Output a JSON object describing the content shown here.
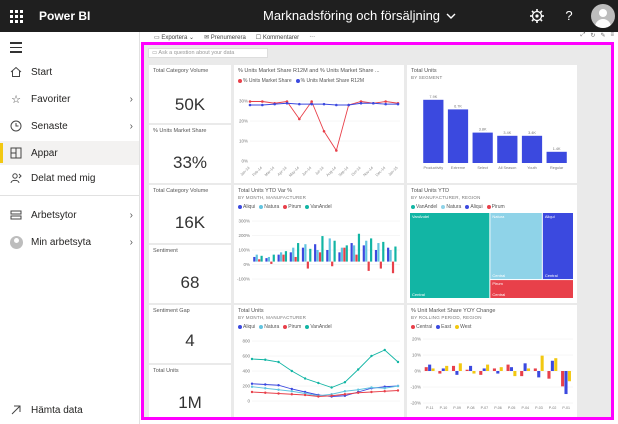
{
  "app": {
    "name": "Power BI",
    "report_title": "Marknadsföring och försäljning"
  },
  "icons": {
    "waffle": "waffle-icon",
    "title_chevron": "chevron-down-icon",
    "settings": "gear-icon",
    "help": "help-icon",
    "account": "avatar-icon"
  },
  "sidebar": {
    "items": [
      {
        "label": "Start",
        "icon": "home-icon"
      },
      {
        "label": "Favoriter",
        "icon": "star-icon",
        "chevron": "›"
      },
      {
        "label": "Senaste",
        "icon": "clock-icon",
        "chevron": "›"
      },
      {
        "label": "Appar",
        "icon": "apps-icon",
        "active": true
      },
      {
        "label": "Delat med mig",
        "icon": "shared-icon"
      },
      {
        "label": "Arbetsytor",
        "icon": "workspaces-icon",
        "chevron": "›"
      },
      {
        "label": "Min arbetsyta",
        "icon": "avatar-icon",
        "chevron": "›"
      }
    ],
    "footer": {
      "label": "Hämta data",
      "icon": "arrow-up-right-icon"
    }
  },
  "actions": {
    "export": "Exportera",
    "subscribe": "Prenumerera",
    "comments": "Kommentarer",
    "more": "···"
  },
  "qa": {
    "placeholder": "Ask a question about your data"
  },
  "tiles": {
    "card1": {
      "title": "Total Category Volume",
      "value": "50K"
    },
    "card2": {
      "title": "% Units Market Share",
      "value": "33%"
    },
    "card3": {
      "title": "Total Category Volume",
      "value": "16K"
    },
    "card4": {
      "title": "Sentiment",
      "value": "68"
    },
    "card5": {
      "title": "Sentiment Gap",
      "value": "4"
    },
    "card6": {
      "title": "Total Units",
      "value": "1M"
    },
    "line1": {
      "title": "% Units Market Share R12M and % Units Market Share ..."
    },
    "bar1": {
      "title": "Total Units",
      "subtitle": "BY SEGMENT"
    },
    "col1": {
      "title": "Total Units YTD Var %",
      "subtitle": "BY MONTH, MANUFACTURER"
    },
    "tree1": {
      "title": "Total Units YTD",
      "subtitle": "BY MANUFACTURER, REGION"
    },
    "line2": {
      "title": "Total Units",
      "subtitle": "BY MONTH, MANUFACTURER"
    },
    "col2": {
      "title": "% Unit Market Share YOY Change",
      "subtitle": "BY ROLLING PERIOD, REGION"
    }
  },
  "colors": {
    "aliqui": "#3b49df",
    "natura": "#62c4e0",
    "pirum": "#e8404a",
    "vanandel": "#12b5a4",
    "central": "#e8404a",
    "east": "#3b49df",
    "west": "#f2c811",
    "bar": "#3b49df",
    "accent": "#f2c811",
    "selection": "#ff00ff"
  },
  "chart_data": [
    {
      "id": "line1",
      "type": "line",
      "series": [
        {
          "name": "% Units Market Share",
          "color": "#e8404a",
          "values": [
            34,
            34,
            33,
            34,
            24,
            34,
            17,
            6,
            32,
            34,
            33,
            34,
            33
          ]
        },
        {
          "name": "% Units Market Share R12M",
          "color": "#3b49df",
          "values": [
            32,
            32,
            32.5,
            33,
            32.5,
            32.5,
            32.5,
            32,
            32,
            33,
            33,
            32.5,
            32.5
          ]
        }
      ],
      "categories": [
        "Jan-14",
        "Feb-14",
        "Mar-14",
        "Apr-14",
        "May-14",
        "Jun-14",
        "Jul-14",
        "Aug-14",
        "Sep-14",
        "Oct-14",
        "Nov-14",
        "Dec-14",
        "Jan-15"
      ],
      "y_ticks": [
        "30%",
        "20%",
        "10%",
        "0%"
      ],
      "ylim": [
        0,
        40
      ]
    },
    {
      "id": "bar1",
      "type": "bar",
      "categories": [
        "Productivity",
        "Extreme",
        "Select",
        "All Season",
        "Youth",
        "Regular"
      ],
      "values": [
        7.9,
        6.7,
        3.8,
        3.4,
        3.4,
        1.4
      ],
      "data_labels": [
        "7.9K",
        "6.7K",
        "3.8K",
        "3.4K",
        "3.4K",
        "1.4K"
      ]
    },
    {
      "id": "col1",
      "type": "bar",
      "legend": [
        {
          "name": "Aliqui",
          "color": "#3b49df"
        },
        {
          "name": "Natura",
          "color": "#62c4e0"
        },
        {
          "name": "Pirum",
          "color": "#e8404a"
        },
        {
          "name": "VanAndel",
          "color": "#12b5a4"
        }
      ],
      "y_ticks": [
        "300%",
        "200%",
        "100%",
        "0%",
        "-100%"
      ],
      "ylim": [
        -150,
        350
      ],
      "series": [
        {
          "name": "Aliqui",
          "values": [
            40,
            30,
            60,
            80,
            120,
            150,
            100,
            80,
            160,
            140,
            100,
            120
          ]
        },
        {
          "name": "Natura",
          "values": [
            60,
            40,
            80,
            120,
            150,
            100,
            200,
            120,
            140,
            180,
            160,
            100
          ]
        },
        {
          "name": "Pirum",
          "values": [
            20,
            -20,
            60,
            40,
            -60,
            80,
            -40,
            120,
            60,
            -80,
            -60,
            -100
          ]
        },
        {
          "name": "VanAndel",
          "values": [
            50,
            60,
            90,
            160,
            110,
            220,
            180,
            140,
            240,
            200,
            170,
            130
          ]
        }
      ]
    },
    {
      "id": "tree1",
      "type": "heatmap",
      "cells": [
        {
          "label": "VanAndel",
          "sub": "Central",
          "value": 45,
          "color": "#12b5a4"
        },
        {
          "label": "Natura",
          "sub": "Central",
          "value": 25,
          "color": "#8fd3e8"
        },
        {
          "label": "Aliqui",
          "sub": "Central",
          "value": 18,
          "color": "#3b49df"
        },
        {
          "label": "Pirum",
          "sub": "Central",
          "value": 12,
          "color": "#e8404a"
        }
      ]
    },
    {
      "id": "line2",
      "type": "line",
      "y_ticks": [
        "800",
        "600",
        "400",
        "200",
        "0"
      ],
      "ylim": [
        0,
        800
      ],
      "series": [
        {
          "name": "Aliqui",
          "values": [
            230,
            220,
            210,
            160,
            120,
            80,
            60,
            70,
            120,
            170,
            190,
            200
          ]
        },
        {
          "name": "Natura",
          "values": [
            190,
            170,
            150,
            130,
            100,
            70,
            90,
            130,
            150,
            180,
            170,
            200
          ]
        },
        {
          "name": "Pirum",
          "values": [
            120,
            110,
            100,
            90,
            80,
            60,
            70,
            90,
            110,
            120,
            130,
            140
          ]
        },
        {
          "name": "VanAndel",
          "values": [
            560,
            550,
            520,
            400,
            300,
            240,
            180,
            250,
            420,
            600,
            680,
            520
          ]
        }
      ]
    },
    {
      "id": "col2",
      "type": "bar",
      "legend": [
        {
          "name": "Central",
          "color": "#e8404a"
        },
        {
          "name": "East",
          "color": "#3b49df"
        },
        {
          "name": "West",
          "color": "#f2c811"
        }
      ],
      "y_ticks": [
        "20%",
        "10%",
        "0%",
        "-10%",
        "-20%"
      ],
      "ylim": [
        -25,
        25
      ],
      "categories": [
        "P-11",
        "P-10",
        "P-09",
        "P-08",
        "P-07",
        "P-06",
        "P-05",
        "P-04",
        "P-03",
        "P-02",
        "P-01"
      ],
      "series": [
        {
          "name": "Central",
          "values": [
            3,
            -2,
            4,
            1,
            -3,
            2,
            5,
            -4,
            2,
            -6,
            -12
          ]
        },
        {
          "name": "East",
          "values": [
            5,
            2,
            -3,
            4,
            2,
            -2,
            3,
            6,
            -5,
            8,
            -18
          ]
        },
        {
          "name": "West",
          "values": [
            2,
            4,
            6,
            -2,
            5,
            3,
            -4,
            2,
            12,
            10,
            -8
          ]
        }
      ]
    }
  ]
}
